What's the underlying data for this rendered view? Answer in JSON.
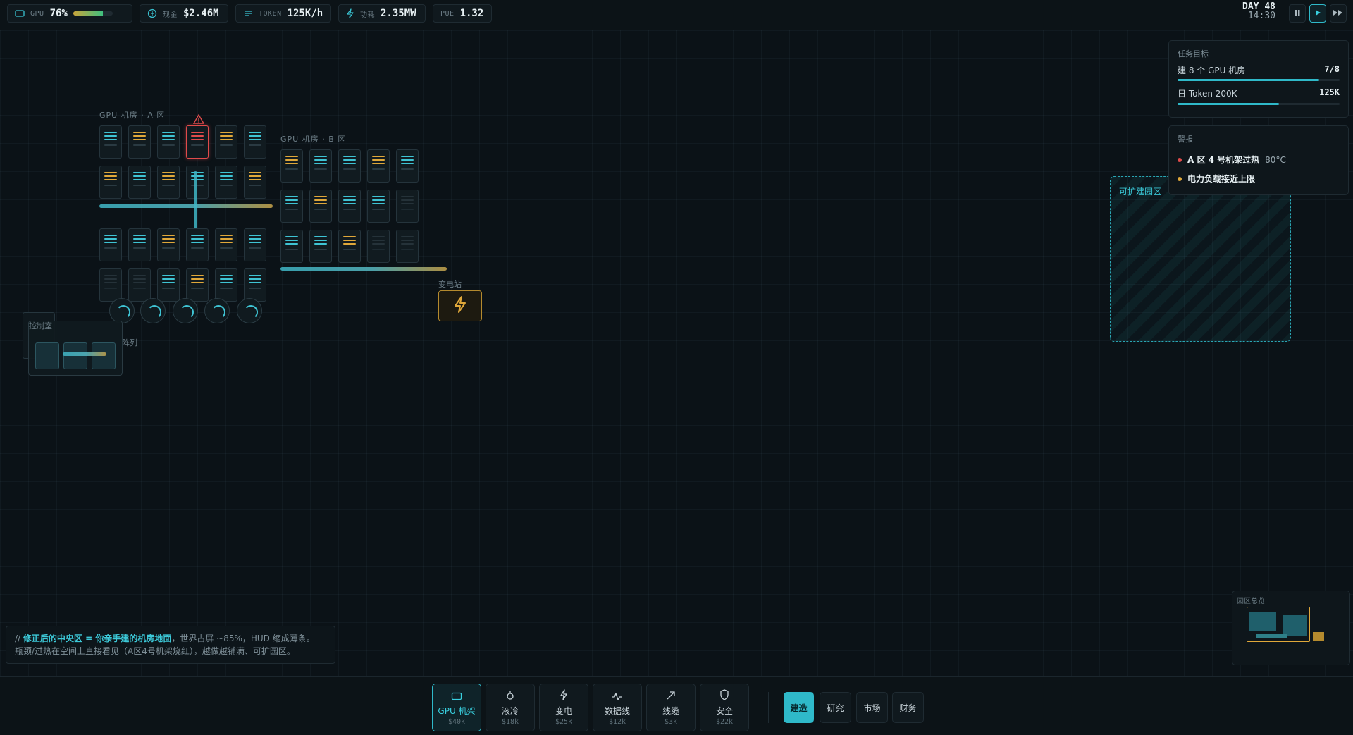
{
  "hud": {
    "gpu_label": "GPU",
    "gpu_value": "76%",
    "gpu_level": 0.76,
    "cash_label": "现金",
    "cash_value": "$2.46M",
    "token_label": "TOKEN",
    "token_value": "125K/h",
    "power_label": "功耗",
    "power_value": "2.35MW",
    "pue_label": "PUE",
    "pue_value": "1.32",
    "day": "DAY 48",
    "time": "14:30",
    "speed_controls": [
      "pause",
      "play",
      "fast-forward"
    ],
    "active_speed": "play"
  },
  "world": {
    "zone_a_label": "GPU 机房 · A 区",
    "zone_b_label": "GPU 机房 · B 区",
    "control_room_label": "控制室",
    "cooling_label": "阵列",
    "substation_label": "变电站",
    "expand_label": "可扩建园区",
    "zone_a_racks": [
      [
        "cyan",
        "amber",
        "cyan",
        "hot",
        "amber",
        "cyan"
      ],
      [
        "amber",
        "cyan",
        "amber",
        "cyan",
        "cyan",
        "amber"
      ],
      [
        "cyan",
        "cyan",
        "amber",
        "cyan",
        "amber",
        "cyan"
      ],
      [
        "dim",
        "dim",
        "cyan",
        "amber",
        "cyan",
        "cyan"
      ]
    ],
    "zone_b_racks": [
      [
        "amber",
        "cyan",
        "cyan",
        "amber",
        "cyan"
      ],
      [
        "cyan",
        "amber",
        "cyan",
        "cyan",
        "dim"
      ],
      [
        "cyan",
        "cyan",
        "amber",
        "dim",
        "dim"
      ]
    ]
  },
  "objectives": {
    "title": "任务目标",
    "items": [
      {
        "label": "建 8 个 GPU 机房",
        "value": "7/8",
        "progress": 0.875
      },
      {
        "label": "日 Token 200K",
        "value": "125K",
        "progress": 0.625
      }
    ]
  },
  "alerts": {
    "title": "警报",
    "items": [
      {
        "strong": "A 区 4 号机架过热",
        "detail": "80°C",
        "color": "#e04b4b"
      },
      {
        "strong": "电力负载接近上限",
        "detail": "",
        "color": "#e0a83a"
      }
    ]
  },
  "minimap": {
    "title": "园区总览"
  },
  "note": {
    "prefix": "// ",
    "highlight": "修正后的中央区 = 你亲手建的机房地面",
    "line1_rest": "，世界占屏 ~85%，HUD 缩成薄条。",
    "line2": "瓶颈/过热在空间上直接看见（A区4号机架烧红），越做越铺满、可扩园区。"
  },
  "toolbar": {
    "tools": [
      {
        "label": "GPU 机架",
        "price": "$40k",
        "icon": "rack-icon"
      },
      {
        "label": "液冷",
        "price": "$18k",
        "icon": "droplet-icon"
      },
      {
        "label": "变电",
        "price": "$25k",
        "icon": "bolt-icon"
      },
      {
        "label": "数据线",
        "price": "$12k",
        "icon": "pulse-icon"
      },
      {
        "label": "线缆",
        "price": "$3k",
        "icon": "arrow-icon"
      },
      {
        "label": "安全",
        "price": "$22k",
        "icon": "shield-icon"
      }
    ],
    "tabs": [
      "建造",
      "研究",
      "市场",
      "财务"
    ],
    "active_tab": "建造"
  },
  "colors": {
    "accent": "#2fb9c9",
    "warn": "#e0a83a",
    "danger": "#e04b4b"
  }
}
